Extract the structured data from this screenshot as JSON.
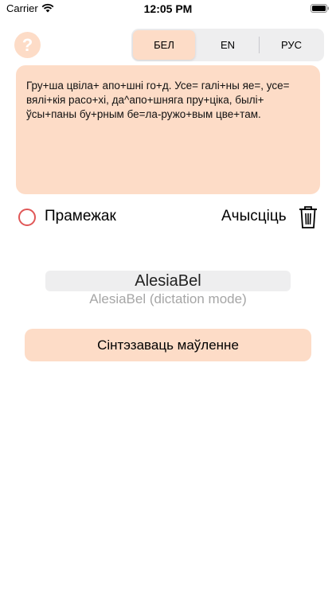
{
  "status_bar": {
    "carrier": "Carrier",
    "time": "12:05 PM"
  },
  "help": {
    "label": "?"
  },
  "language_switch": {
    "tabs": [
      "БЕЛ",
      "EN",
      "РУС"
    ],
    "selected": "БЕЛ"
  },
  "text_input": {
    "value": "Гру+ша цвіла+ апо+шні го+д. Усе= галі+ны яе=, усе= вялі+кія расо+хі, да^апо+шняга пру+ціка, былі+ ўсы+паны бу+рным бе=ла-ружо+вым цве+там."
  },
  "pause": {
    "label": "Прамежак",
    "checked": false
  },
  "clear": {
    "label": "Ачысціць"
  },
  "voice_picker": {
    "selected": "AlesiaBel",
    "option": "AlesiaBel (dictation mode)"
  },
  "synthesize_button": {
    "label": "Сінтэзаваць маўленне"
  },
  "colors": {
    "accent": "#fddcc7",
    "checkbox": "#e05757",
    "control_bg": "#eeeeef"
  }
}
